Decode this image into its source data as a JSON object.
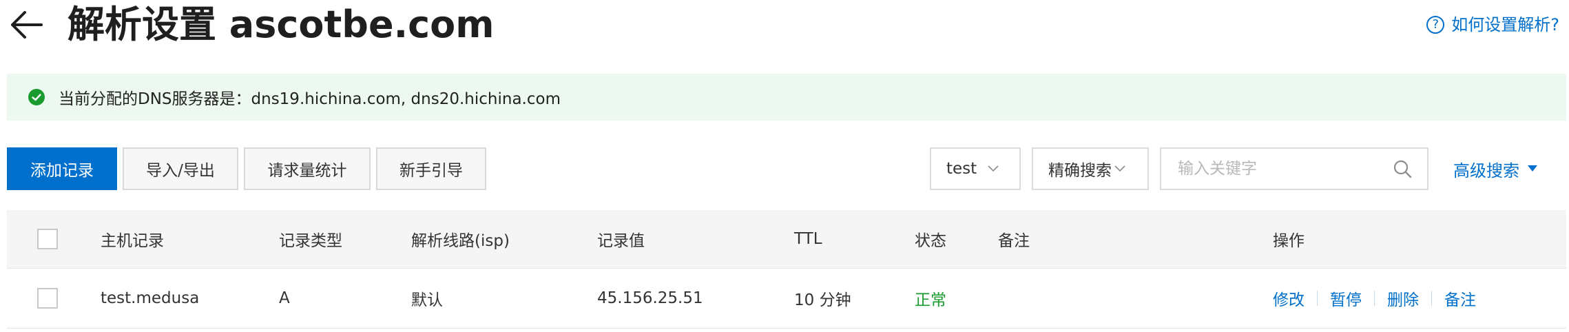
{
  "header": {
    "title": "解析设置 ascotbe.com",
    "help_link": "如何设置解析?",
    "help_icon": "question-circle-icon"
  },
  "notice": {
    "text": "当前分配的DNS服务器是：dns19.hichina.com, dns20.hichina.com",
    "icon": "check-circle-icon",
    "color": "#1a9b2f"
  },
  "toolbar": {
    "add_record": "添加记录",
    "import_export": "导入/导出",
    "request_stats": "请求量统计",
    "beginner_guide": "新手引导",
    "filter_value": "test",
    "search_mode": "精确搜索",
    "search_placeholder": "输入关键字",
    "search_value": "",
    "advanced_search": "高级搜索"
  },
  "table": {
    "columns": {
      "host": "主机记录",
      "type": "记录类型",
      "line": "解析线路(isp)",
      "value": "记录值",
      "ttl": "TTL",
      "status": "状态",
      "remark": "备注",
      "actions": "操作"
    },
    "rows": [
      {
        "host": "test.medusa",
        "type": "A",
        "line": "默认",
        "value": "45.156.25.51",
        "ttl": "10 分钟",
        "status": "正常",
        "remark": "",
        "actions": [
          "修改",
          "暂停",
          "删除",
          "备注"
        ]
      }
    ]
  },
  "colors": {
    "accent": "#0070cc",
    "success": "#1a9b2f",
    "notice_bg": "#edf9f0"
  }
}
